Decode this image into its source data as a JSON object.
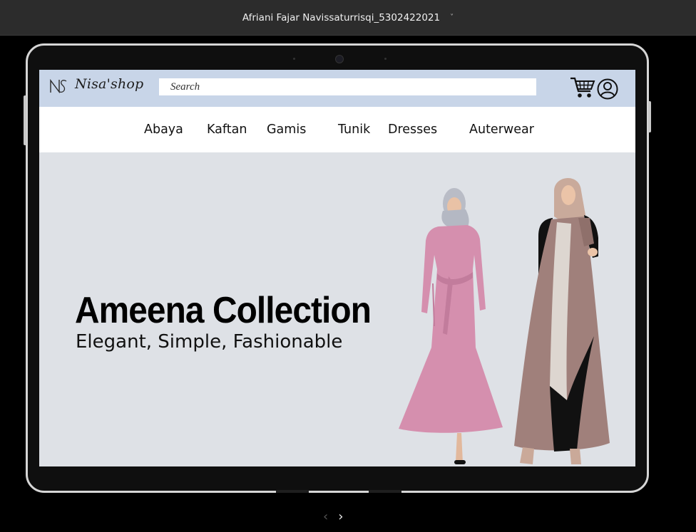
{
  "topbar": {
    "title": "Afriani Fajar Navissaturrisqi_5302422021",
    "chevron": "˅"
  },
  "header": {
    "logo_text": "Nisa'shop",
    "search_placeholder": "Search",
    "icons": [
      "logo-mark-icon",
      "cart-icon",
      "user-icon"
    ]
  },
  "nav": {
    "items": [
      "Abaya",
      "Kaftan",
      "Gamis",
      "Tunik",
      "Dresses",
      "Auterwear"
    ]
  },
  "hero": {
    "title": "Ameena Collection",
    "subtitle": "Elegant, Simple, Fashionable",
    "colors": {
      "background": "#dee1e6",
      "header": "#c8d5e8",
      "pink_dress": "#d58fae",
      "mauve_abaya": "#a0807b"
    }
  },
  "pager": {
    "prev": "‹",
    "next": "›"
  }
}
